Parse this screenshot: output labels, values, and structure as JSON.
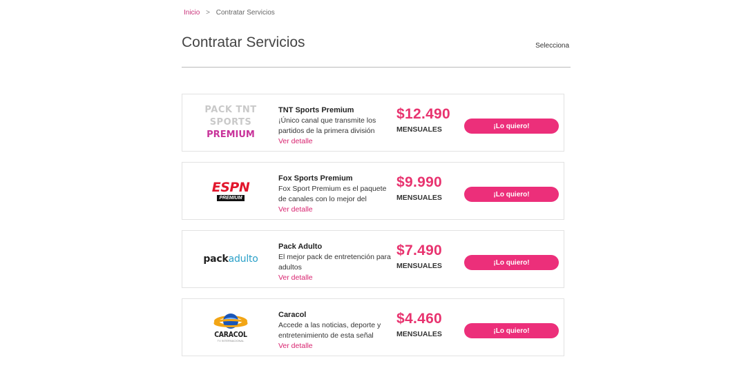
{
  "breadcrumb": {
    "home": "Inicio",
    "separator": ">",
    "current": "Contratar Servicios"
  },
  "header": {
    "title": "Contratar Servicios",
    "select_label": "Selecciona"
  },
  "services": [
    {
      "logo": {
        "line1": "PACK TNT SPORTS",
        "line2": "PREMIUM"
      },
      "name": "TNT Sports Premium",
      "description": "¡Único canal que transmite los partidos de la primera división",
      "detail": "Ver detalle",
      "price": "$12.490",
      "period": "MENSUALES",
      "cta": "¡Lo quiero!"
    },
    {
      "logo": {
        "line1": "ESPN",
        "line2": "PREMIUM"
      },
      "name": "Fox Sports Premium",
      "description": "Fox Sport Premium es el paquete de canales con lo mejor del",
      "detail": "Ver detalle",
      "price": "$9.990",
      "period": "MENSUALES",
      "cta": "¡Lo quiero!"
    },
    {
      "logo": {
        "line1": "pack",
        "line2": "adulto"
      },
      "name": "Pack Adulto",
      "description": "El mejor pack de entretención para adultos",
      "detail": "Ver detalle",
      "price": "$7.490",
      "period": "MENSUALES",
      "cta": "¡Lo quiero!"
    },
    {
      "logo": {
        "line1": "CARACOL",
        "line2": "TV INTERNACIONAL"
      },
      "name": "Caracol",
      "description": "Accede a las noticias, deporte y entretenimiento de esta señal",
      "detail": "Ver detalle",
      "price": "$4.460",
      "period": "MENSUALES",
      "cta": "¡Lo quiero!"
    }
  ],
  "colors": {
    "accent": "#ec2f7a",
    "price": "#e8336f",
    "link": "#d8236f"
  }
}
